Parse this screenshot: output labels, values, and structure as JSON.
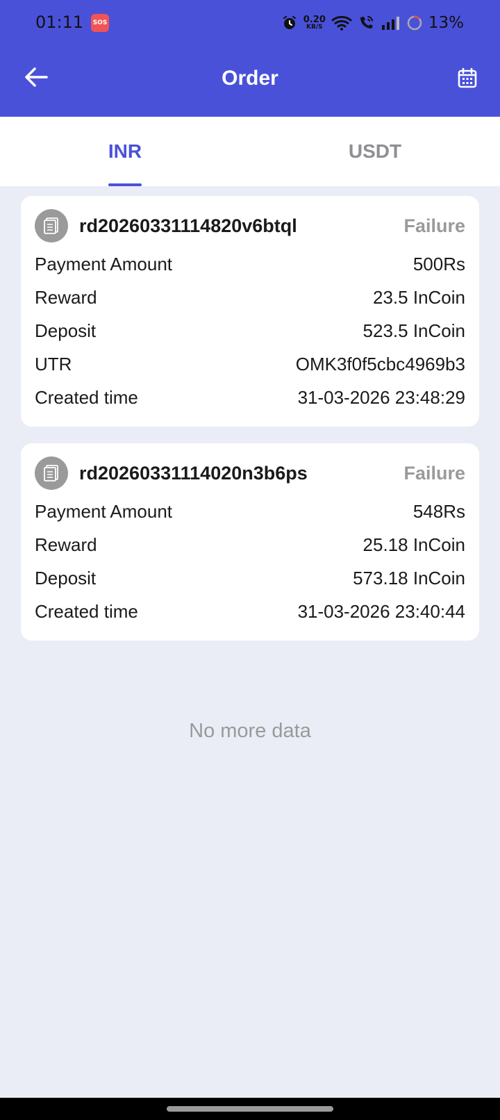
{
  "status_bar": {
    "time": "01:11",
    "sos": "SOS",
    "net_speed_value": "0.20",
    "net_speed_unit": "KB/S",
    "battery": "13%",
    "icons": [
      "alarm-icon",
      "wifi-icon",
      "wifi-call-icon",
      "signal-icon",
      "battery-icon"
    ]
  },
  "app_bar": {
    "title": "Order",
    "back_icon": "arrow-left-icon",
    "calendar_icon": "calendar-icon"
  },
  "tabs": [
    {
      "label": "INR",
      "active": true
    },
    {
      "label": "USDT",
      "active": false
    }
  ],
  "orders": [
    {
      "id": "rd20260331114820v6btql",
      "status": "Failure",
      "rows": [
        {
          "label": "Payment Amount",
          "value": "500Rs"
        },
        {
          "label": "Reward",
          "value": "23.5 InCoin"
        },
        {
          "label": "Deposit",
          "value": "523.5 InCoin"
        },
        {
          "label": "UTR",
          "value": "OMK3f0f5cbc4969b3"
        },
        {
          "label": "Created time",
          "value": "31-03-2026 23:48:29"
        }
      ]
    },
    {
      "id": "rd20260331114020n3b6ps",
      "status": "Failure",
      "rows": [
        {
          "label": "Payment Amount",
          "value": "548Rs"
        },
        {
          "label": "Reward",
          "value": "25.18 InCoin"
        },
        {
          "label": "Deposit",
          "value": "573.18 InCoin"
        },
        {
          "label": "Created time",
          "value": "31-03-2026 23:40:44"
        }
      ]
    }
  ],
  "footer_text": "No more data",
  "colors": {
    "primary": "#4a51d9",
    "background": "#eaedf6",
    "failure_status": "#9a9a9a"
  }
}
